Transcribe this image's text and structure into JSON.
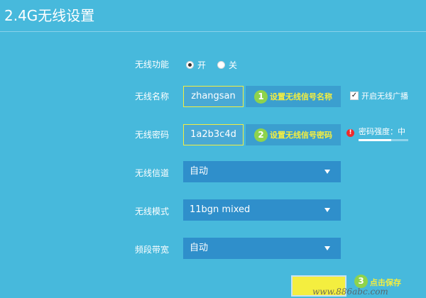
{
  "page": {
    "title": "2.4G无线设置"
  },
  "wireless_function": {
    "label": "无线功能",
    "options": [
      "开",
      "关"
    ],
    "selected": "开"
  },
  "ssid": {
    "label": "无线名称",
    "value": "zhangsan",
    "step_number": "1",
    "hint": "设置无线信号名称",
    "broadcast_label": "开启无线广播",
    "broadcast_checked": true
  },
  "password": {
    "label": "无线密码",
    "value": "1a2b3c4d",
    "step_number": "2",
    "hint": "设置无线信号密码",
    "strength_text": "密码强度：中",
    "strength_level": 0.66
  },
  "channel": {
    "label": "无线信道",
    "value": "自动"
  },
  "mode": {
    "label": "无线模式",
    "value": "11bgn mixed"
  },
  "bandwidth": {
    "label": "频段带宽",
    "value": "自动"
  },
  "save": {
    "step_number": "3",
    "hint": "点击保存"
  },
  "watermark": "www.886abc.com",
  "colors": {
    "background": "#47b9dc",
    "accent_yellow": "#f4ee3f",
    "step_badge": "#8ed34c",
    "warning": "#ef2b2b"
  },
  "icons": {
    "checkbox": "check-icon",
    "warning": "exclamation-icon",
    "select": "chevron-down-icon"
  }
}
